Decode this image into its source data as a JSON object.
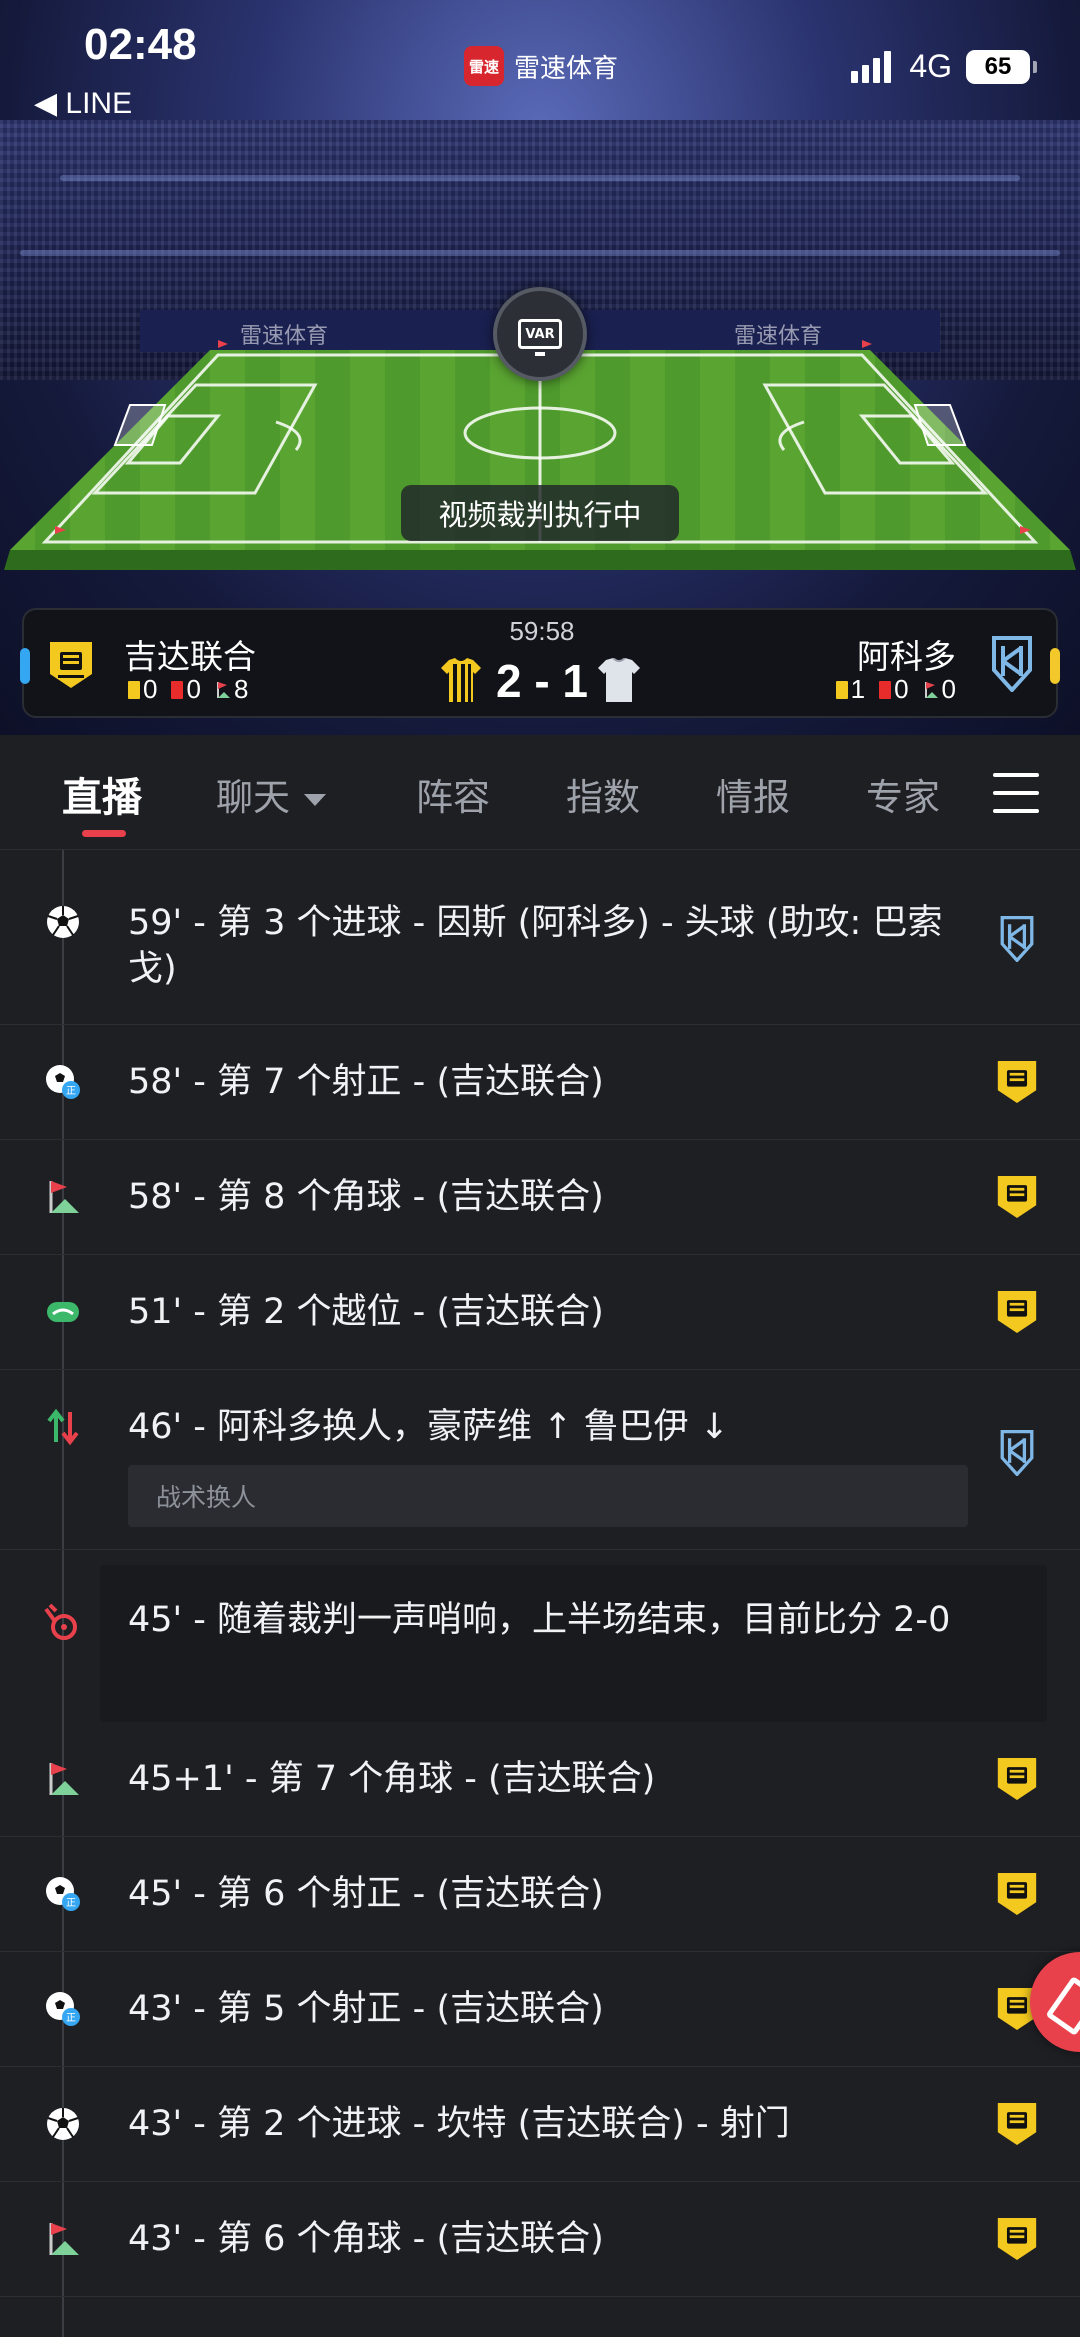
{
  "status_bar": {
    "time": "02:48",
    "back_label": "◀ LINE",
    "network": "4G",
    "battery": "65"
  },
  "app": {
    "logo_text": "雷速",
    "name": "雷速体育"
  },
  "stadium": {
    "ad_text": "雷速体育",
    "var_label": "VAR",
    "var_status": "视频裁判执行中"
  },
  "scoreboard": {
    "match_time": "59:58",
    "score": "2 - 1",
    "home": {
      "name": "吉达联合",
      "yellow": "0",
      "red": "0",
      "corners": "8",
      "color": "#f3c91f"
    },
    "away": {
      "name": "阿科多",
      "yellow": "1",
      "red": "0",
      "corners": "0",
      "color": "#7fb7e6"
    }
  },
  "tabs": [
    "直播",
    "聊天",
    "阵容",
    "指数",
    "情报",
    "专家"
  ],
  "events": [
    {
      "text": "59' - 第 3 个进球 - 因斯 (阿科多) - 头球 (助攻: 巴索戈)",
      "icon": "goal-icon",
      "team": "away"
    },
    {
      "text": "58' - 第 7 个射正 - (吉达联合)",
      "icon": "shot-on-target-icon",
      "team": "home"
    },
    {
      "text": "58' - 第 8 个角球 - (吉达联合)",
      "icon": "corner-flag-icon",
      "team": "home"
    },
    {
      "text": "51' - 第 2 个越位 - (吉达联合)",
      "icon": "offside-icon",
      "team": "home"
    },
    {
      "text": "46' - 阿科多换人，豪萨维 ↑ 鲁巴伊 ↓",
      "note": "战术换人",
      "icon": "substitution-icon",
      "team": "away"
    },
    {
      "text": "45' - 随着裁判一声哨响，上半场结束，目前比分 2-0",
      "icon": "whistle-icon",
      "team": ""
    },
    {
      "text": "45+1' - 第 7 个角球 - (吉达联合)",
      "icon": "corner-flag-icon",
      "team": "home"
    },
    {
      "text": "45' - 第 6 个射正 - (吉达联合)",
      "icon": "shot-on-target-icon",
      "team": "home"
    },
    {
      "text": "43' - 第 5 个射正 - (吉达联合)",
      "icon": "shot-on-target-icon",
      "team": "home"
    },
    {
      "text": "43' - 第 2 个进球 - 坎特 (吉达联合) - 射门",
      "icon": "goal-icon",
      "team": "home"
    },
    {
      "text": "43' - 第 6 个角球 - (吉达联合)",
      "icon": "corner-flag-icon",
      "team": "home"
    }
  ]
}
